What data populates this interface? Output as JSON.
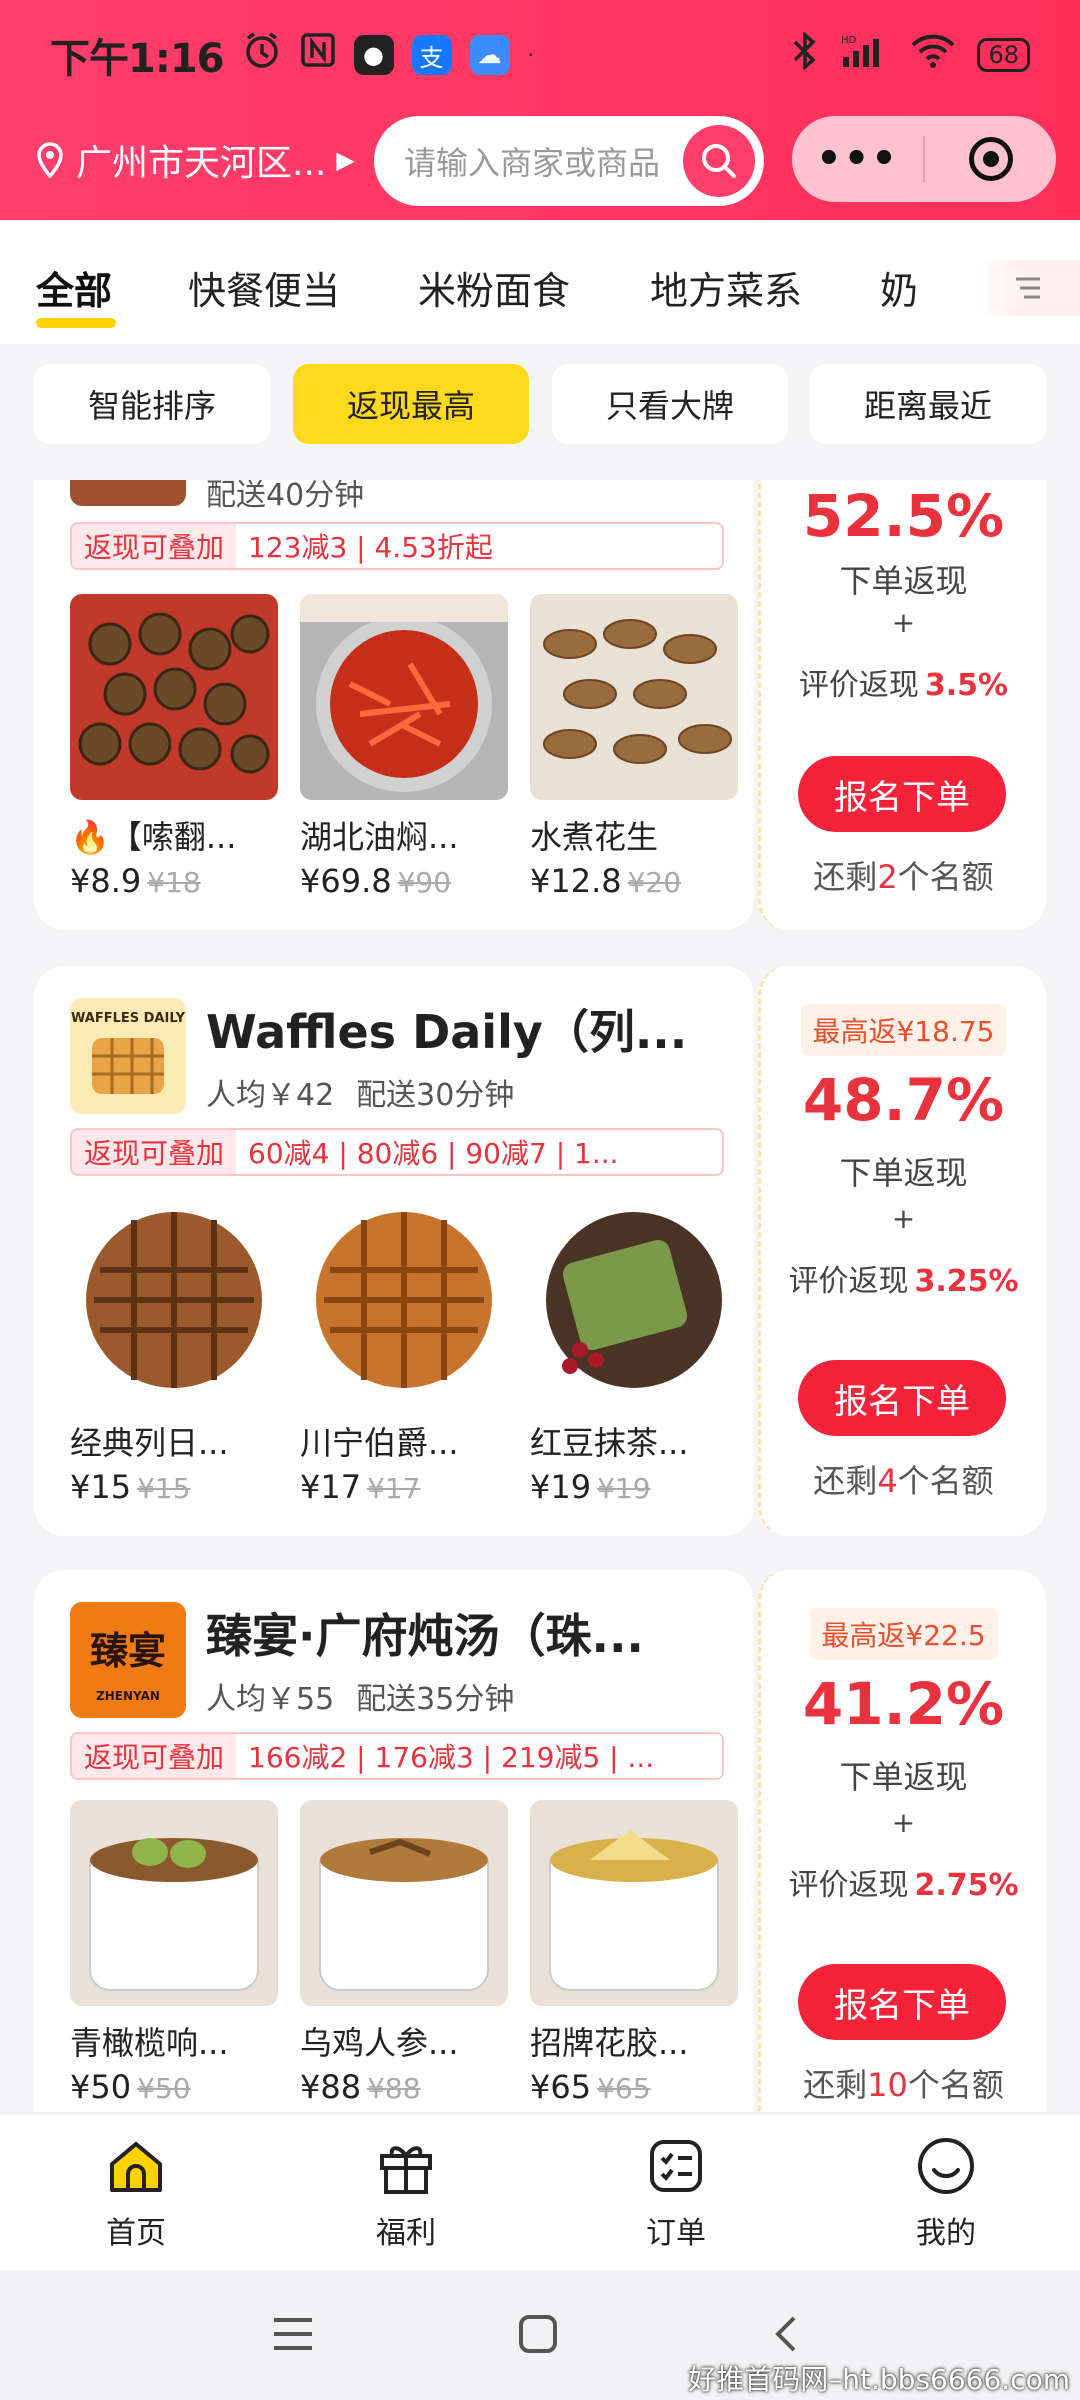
{
  "status": {
    "time": "下午1:16",
    "battery": "68"
  },
  "header": {
    "location": "广州市天河区...",
    "search_placeholder": "请输入商家或商品"
  },
  "categories": [
    "全部",
    "快餐便当",
    "米粉面食",
    "地方菜系",
    "奶"
  ],
  "sorts": [
    "智能排序",
    "返现最高",
    "只看大牌",
    "距离最近"
  ],
  "stores": [
    {
      "name": "",
      "meta_avg": "",
      "meta_delivery": "配送40分钟",
      "promo_tag": "返现可叠加",
      "promo_text": "123减3 | 4.53折起",
      "products": [
        {
          "name": "🔥【嗦翻...",
          "price": "¥8.9",
          "orig": "¥18"
        },
        {
          "name": "湖北油焖...",
          "price": "¥69.8",
          "orig": "¥90"
        },
        {
          "name": "水煮花生",
          "price": "¥12.8",
          "orig": "¥20"
        }
      ],
      "max_return": "",
      "rate": "52.5%",
      "rate_label": "下单返现",
      "plus": "+",
      "review_label": "评价返现",
      "review_rate": "3.5%",
      "signup": "报名下单",
      "remain_pre": "还剩",
      "remain_num": "2",
      "remain_post": "个名额"
    },
    {
      "name": "Waffles Daily（列...",
      "meta_avg": "人均￥42",
      "meta_delivery": "配送30分钟",
      "promo_tag": "返现可叠加",
      "promo_text": "60减4 | 80减6 | 90减7 | 1...",
      "products": [
        {
          "name": "经典列日...",
          "price": "¥15",
          "orig": "¥15"
        },
        {
          "name": "川宁伯爵...",
          "price": "¥17",
          "orig": "¥17"
        },
        {
          "name": "红豆抹茶...",
          "price": "¥19",
          "orig": "¥19"
        }
      ],
      "max_return": "最高返¥18.75",
      "rate": "48.7%",
      "rate_label": "下单返现",
      "plus": "+",
      "review_label": "评价返现",
      "review_rate": "3.25%",
      "signup": "报名下单",
      "remain_pre": "还剩",
      "remain_num": "4",
      "remain_post": "个名额"
    },
    {
      "name": "臻宴·广府炖汤（珠...",
      "meta_avg": "人均￥55",
      "meta_delivery": "配送35分钟",
      "promo_tag": "返现可叠加",
      "promo_text": "166减2 | 176减3 | 219减5 | ...",
      "products": [
        {
          "name": "青橄榄响...",
          "price": "¥50",
          "orig": "¥50"
        },
        {
          "name": "乌鸡人参...",
          "price": "¥88",
          "orig": "¥88"
        },
        {
          "name": "招牌花胶...",
          "price": "¥65",
          "orig": "¥65"
        }
      ],
      "max_return": "最高返¥22.5",
      "rate": "41.2%",
      "rate_label": "下单返现",
      "plus": "+",
      "review_label": "评价返现",
      "review_rate": "2.75%",
      "signup": "报名下单",
      "remain_pre": "还剩",
      "remain_num": "10",
      "remain_post": "个名额"
    }
  ],
  "logos": {
    "waffles_text": "WAFFLES DAILY",
    "zhenyan_text": "臻宴",
    "zhenyan_sub": "ZHENYAN"
  },
  "tabs": [
    "首页",
    "福利",
    "订单",
    "我的"
  ],
  "watermark": "好推首码网–ht.bbs6666.com",
  "colors": {
    "brand": "#ff3e6c",
    "accent_yellow": "#ffd200",
    "red": "#e8323e"
  }
}
